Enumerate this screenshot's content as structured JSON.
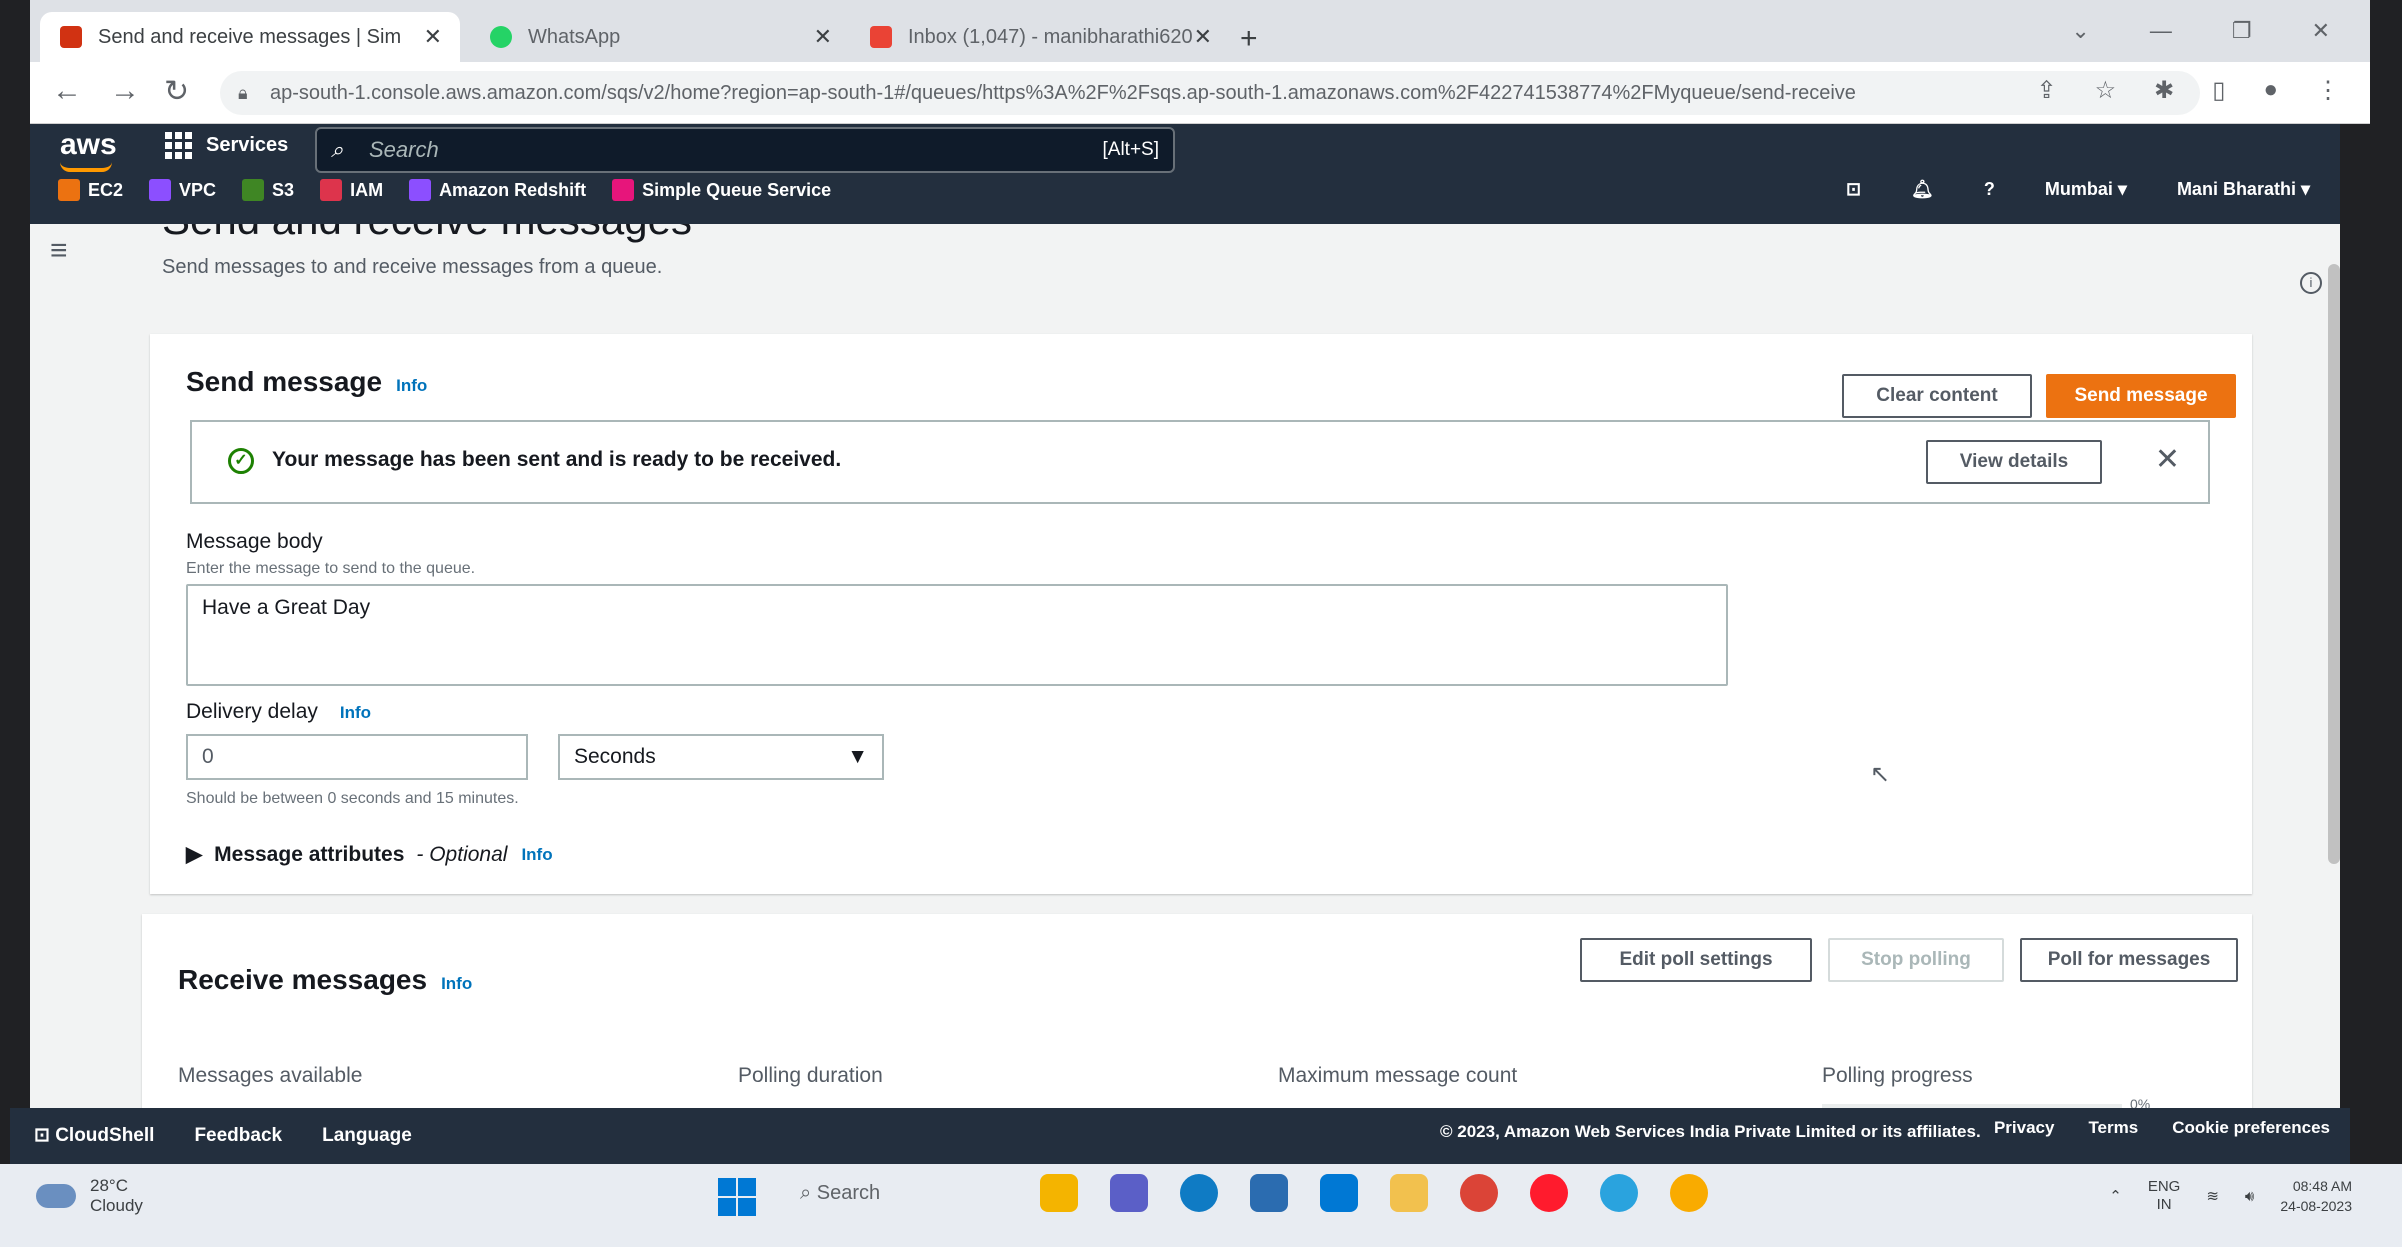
{
  "browser": {
    "tabs": [
      {
        "label": "Send and receive messages | Sim",
        "favicon_color": "#d13212",
        "active": true
      },
      {
        "label": "WhatsApp",
        "favicon_color": "#25d366",
        "active": false
      },
      {
        "label": "Inbox (1,047) - manibharathi620",
        "favicon_color": "#ea4335",
        "active": false
      }
    ],
    "new_tab_label": "+",
    "url": "ap-south-1.console.aws.amazon.com/sqs/v2/home?region=ap-south-1#/queues/https%3A%2F%2Fsqs.ap-south-1.amazonaws.com%2F422741538774%2FMyqueue/send-receive"
  },
  "aws_header": {
    "logo": "aws",
    "services_label": "Services",
    "search_placeholder": "Search",
    "search_shortcut": "[Alt+S]",
    "region": "Mumbai ▾",
    "user": "Mani Bharathi ▾",
    "favorites": [
      {
        "label": "EC2",
        "color": "#ec7211"
      },
      {
        "label": "VPC",
        "color": "#8c4fff"
      },
      {
        "label": "S3",
        "color": "#3f8624"
      },
      {
        "label": "IAM",
        "color": "#dd344c"
      },
      {
        "label": "Amazon Redshift",
        "color": "#8c4fff"
      },
      {
        "label": "Simple Queue Service",
        "color": "#e7157b"
      }
    ]
  },
  "page": {
    "title": "Send and receive messages",
    "subtitle": "Send messages to and receive messages from a queue."
  },
  "send_panel": {
    "heading": "Send message",
    "info": "Info",
    "clear_button": "Clear content",
    "send_button": "Send message",
    "flash": {
      "text": "Your message has been sent and is ready to be received.",
      "view_details": "View details"
    },
    "message_body": {
      "label": "Message body",
      "description": "Enter the message to send to the queue.",
      "value": "Have a Great Day"
    },
    "delivery_delay": {
      "label": "Delivery delay",
      "info": "Info",
      "value": "0",
      "unit": "Seconds",
      "hint": "Should be between 0 seconds and 15 minutes."
    },
    "attributes": {
      "label": "Message attributes",
      "optional": "- Optional",
      "info": "Info"
    }
  },
  "receive_panel": {
    "heading": "Receive messages",
    "info": "Info",
    "edit_button": "Edit poll settings",
    "stop_button": "Stop polling",
    "poll_button": "Poll for messages",
    "columns": [
      "Messages available",
      "Polling duration",
      "Maximum message count",
      "Polling progress"
    ],
    "progress_percent": "0%"
  },
  "footer": {
    "cloudshell": "CloudShell",
    "feedback": "Feedback",
    "language": "Language",
    "copyright": "© 2023, Amazon Web Services India Private Limited or its affiliates.",
    "links": [
      "Privacy",
      "Terms",
      "Cookie preferences"
    ]
  },
  "taskbar": {
    "temperature": "28°C",
    "weather": "Cloudy",
    "search": "Search",
    "lang": "ENG",
    "lang_region": "IN",
    "time": "08:48 AM",
    "date": "24-08-2023",
    "apps": [
      {
        "name": "file-explorer",
        "color": "#f4b400"
      },
      {
        "name": "chat",
        "color": "#5b5fc7"
      },
      {
        "name": "edge",
        "color": "#0f7bc4"
      },
      {
        "name": "store",
        "color": "#2b6cb0"
      },
      {
        "name": "mail",
        "color": "#0078d4"
      },
      {
        "name": "folder",
        "color": "#f2c14e"
      },
      {
        "name": "chrome",
        "color": "#db4437"
      },
      {
        "name": "opera",
        "color": "#ff1b2d"
      },
      {
        "name": "telegram",
        "color": "#2aa3de"
      },
      {
        "name": "chrome-canary",
        "color": "#f9ab00"
      }
    ]
  }
}
